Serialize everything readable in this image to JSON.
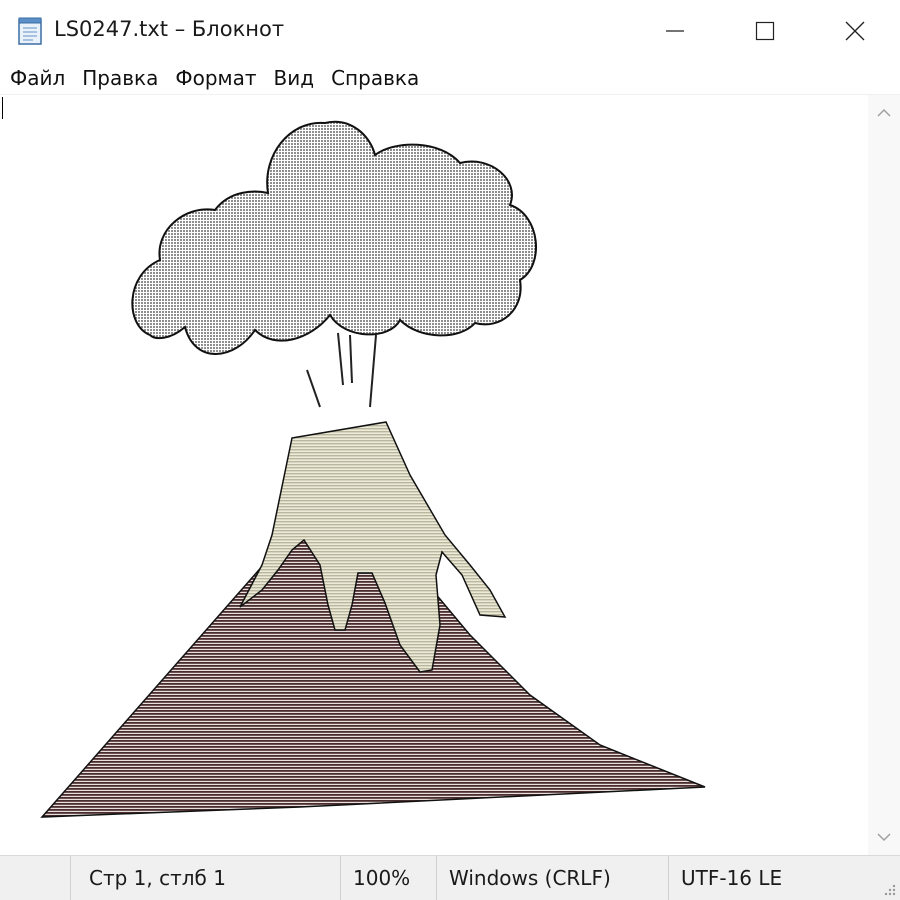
{
  "window": {
    "title": "LS0247.txt – Блокнот",
    "icons": {
      "app": "notepad-icon",
      "minimize": "minimize-icon",
      "maximize": "maximize-icon",
      "close": "close-icon"
    }
  },
  "menu": {
    "items": [
      {
        "label": "Файл",
        "name": "menu-file"
      },
      {
        "label": "Правка",
        "name": "menu-edit"
      },
      {
        "label": "Формат",
        "name": "menu-format"
      },
      {
        "label": "Вид",
        "name": "menu-view"
      },
      {
        "label": "Справка",
        "name": "menu-help"
      }
    ]
  },
  "document": {
    "content_icon": "volcano-ascii-art",
    "colors": {
      "cloud": "#a9a9a9",
      "lava": "#dcdac4",
      "mountain": "#5a3d3d",
      "outline": "#111111"
    }
  },
  "status": {
    "position": "Стр 1, стлб 1",
    "zoom": "100%",
    "line_ending": "Windows (CRLF)",
    "encoding": "UTF-16 LE"
  }
}
